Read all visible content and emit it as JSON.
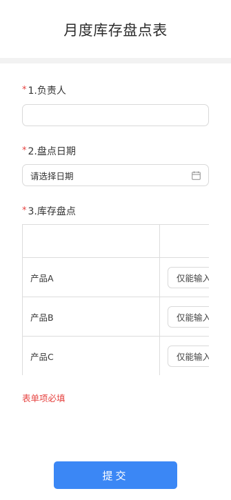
{
  "header": {
    "title": "月度库存盘点表"
  },
  "form": {
    "field1": {
      "required_mark": "*",
      "label": "1.负责人",
      "value": ""
    },
    "field2": {
      "required_mark": "*",
      "label": "2.盘点日期",
      "placeholder": "请选择日期",
      "icon": "calendar-icon"
    },
    "field3": {
      "required_mark": "*",
      "label": "3.库存盘点",
      "table": {
        "header": [
          "",
          ""
        ],
        "rows": [
          {
            "name": "产品A",
            "input_placeholder": "仅能输入"
          },
          {
            "name": "产品B",
            "input_placeholder": "仅能输入"
          },
          {
            "name": "产品C",
            "input_placeholder": "仅能输入"
          }
        ]
      }
    },
    "required_hint": "表单项必填"
  },
  "actions": {
    "submit_label": "提交"
  },
  "colors": {
    "accent": "#3b87f5",
    "required": "#e64340",
    "border": "#d9d9d9",
    "divider": "#f2f2f2"
  }
}
